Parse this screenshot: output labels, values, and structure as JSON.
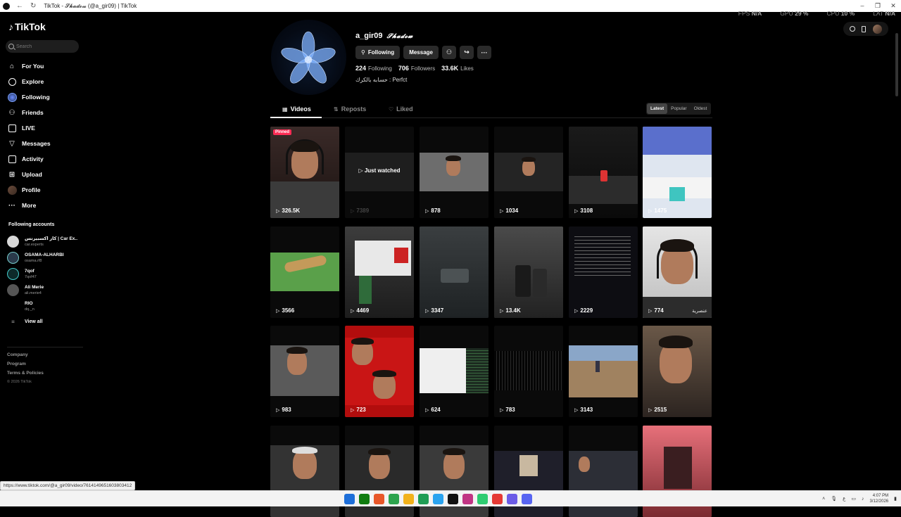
{
  "window": {
    "title": "TikTok - 𝓢𝓱𝓪𝓭𝓸𝔀 (@a_gir09) | TikTok",
    "controls": [
      "–",
      "❐",
      "✕"
    ]
  },
  "perf": [
    {
      "label": "FPS",
      "value": "N/A"
    },
    {
      "label": "GPU",
      "value": "29 %"
    },
    {
      "label": "CPU",
      "value": "10 %"
    },
    {
      "label": "LAT",
      "value": "N/A"
    }
  ],
  "sidebar": {
    "logo": "TikTok",
    "search_placeholder": "Search",
    "nav": [
      {
        "label": "For You",
        "icon": "home-icon"
      },
      {
        "label": "Explore",
        "icon": "compass-icon"
      },
      {
        "label": "Following",
        "icon": "following-icon"
      },
      {
        "label": "Friends",
        "icon": "friends-icon"
      },
      {
        "label": "LIVE",
        "icon": "live-icon"
      },
      {
        "label": "Messages",
        "icon": "messages-icon"
      },
      {
        "label": "Activity",
        "icon": "activity-icon"
      },
      {
        "label": "Upload",
        "icon": "upload-icon"
      },
      {
        "label": "Profile",
        "icon": "profile-avatar-icon"
      },
      {
        "label": "More",
        "icon": "more-icon"
      }
    ],
    "following_title": "Following accounts",
    "accounts": [
      {
        "name": "كار اكسبيرتس | Car Ex...",
        "handle": "car.experts"
      },
      {
        "name": "OSAMA-ALHARBI",
        "handle": "osama.rf8"
      },
      {
        "name": "7qof",
        "handle": "7qof47"
      },
      {
        "name": "Ali Merie",
        "handle": "ali.merie4"
      },
      {
        "name": "RIO",
        "handle": "dq._n"
      }
    ],
    "view_all": "View all",
    "footer": [
      "Company",
      "Program",
      "Terms & Policies"
    ],
    "copyright": "© 2026 TikTok"
  },
  "profile": {
    "username": "a_gir09",
    "display_name": "𝓢𝓱𝓪𝓭𝓸𝔀",
    "following_btn": "Following",
    "message_btn": "Message",
    "stats": [
      {
        "value": "224",
        "label": "Following"
      },
      {
        "value": "706",
        "label": "Followers"
      },
      {
        "value": "33.6K",
        "label": "Likes"
      }
    ],
    "bio": "حسابه بالكرك : Perfct"
  },
  "tabs": [
    {
      "label": "Videos",
      "icon": "grid-icon"
    },
    {
      "label": "Reposts",
      "icon": "repost-icon"
    },
    {
      "label": "Liked",
      "icon": "liked-icon"
    }
  ],
  "sort": [
    "Latest",
    "Popular",
    "Oldest"
  ],
  "videos": [
    {
      "views": "326.5K",
      "caption": "",
      "pinned": "Pinned"
    },
    {
      "views": "7389",
      "caption": "",
      "overlay": "Just watched"
    },
    {
      "views": "878",
      "caption": ""
    },
    {
      "views": "1034",
      "caption": ""
    },
    {
      "views": "3108",
      "caption": ""
    },
    {
      "views": "1475",
      "caption": ""
    },
    {
      "views": "3566",
      "caption": ""
    },
    {
      "views": "4469",
      "caption": ""
    },
    {
      "views": "3347",
      "caption": ""
    },
    {
      "views": "13.4K",
      "caption": ""
    },
    {
      "views": "2229",
      "caption": ""
    },
    {
      "views": "774",
      "caption": "عنصرية"
    },
    {
      "views": "983",
      "caption": ""
    },
    {
      "views": "723",
      "caption": ""
    },
    {
      "views": "624",
      "caption": ""
    },
    {
      "views": "783",
      "caption": ""
    },
    {
      "views": "3143",
      "caption": ""
    },
    {
      "views": "2515",
      "caption": ""
    },
    {
      "views": "",
      "caption": ""
    },
    {
      "views": "",
      "caption": ""
    },
    {
      "views": "",
      "caption": ""
    },
    {
      "views": "",
      "caption": ""
    },
    {
      "views": "",
      "caption": ""
    },
    {
      "views": "",
      "caption": ""
    }
  ],
  "status_url": "https://www.tiktok.com/@a_gir09/video/7614149651603803412",
  "taskbar": {
    "time": "4:07 PM",
    "date": "3/12/2026",
    "lang": "ع",
    "app_colors": [
      "#1e6fd9",
      "#107c10",
      "#e8572a",
      "#2da44e",
      "#f2b21c",
      "#1f9d55",
      "#2aa3ef",
      "#111111",
      "#c13584",
      "#2ecc71",
      "#e53935",
      "#6c5ce7",
      "#5865f2"
    ]
  }
}
